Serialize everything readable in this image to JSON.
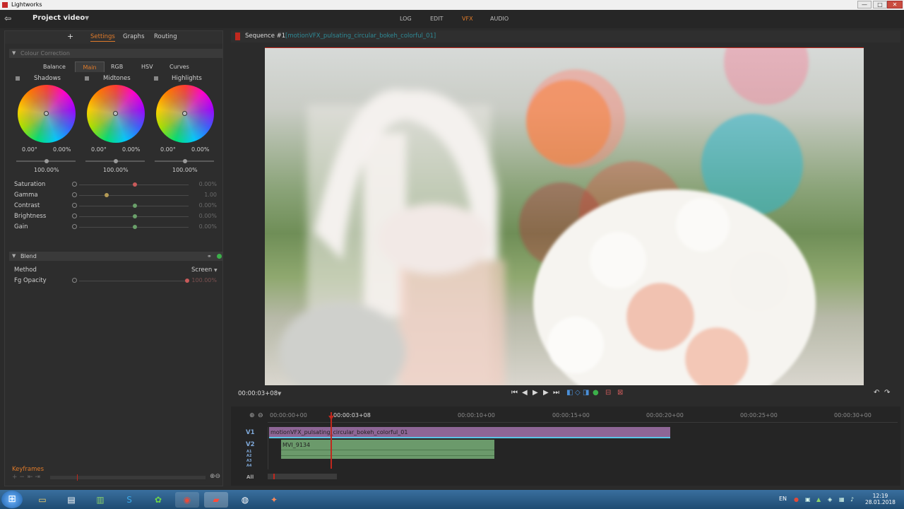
{
  "app": {
    "title": "Lightworks"
  },
  "window_buttons": [
    "—",
    "□",
    "✕"
  ],
  "topbar": {
    "project_name": "Project video",
    "modes": [
      "LOG",
      "EDIT",
      "VFX",
      "AUDIO"
    ]
  },
  "panel": {
    "add": "+",
    "tabs": [
      "Settings",
      "Graphs",
      "Routing"
    ],
    "colour_correction": {
      "title": "Colour Correction",
      "sub_tabs": [
        "Balance",
        "Main",
        "RGB",
        "HSV",
        "Curves"
      ],
      "wheels": [
        {
          "label": "Shadows",
          "val1": "0.00°",
          "val2": "0.00%",
          "level": "100.00%"
        },
        {
          "label": "Midtones",
          "val1": "0.00°",
          "val2": "0.00%",
          "level": "100.00%"
        },
        {
          "label": "Highlights",
          "val1": "0.00°",
          "val2": "0.00%",
          "level": "100.00%"
        }
      ],
      "params": [
        {
          "label": "Saturation",
          "value": "0.00%"
        },
        {
          "label": "Gamma",
          "value": "1.00"
        },
        {
          "label": "Contrast",
          "value": "0.00%"
        },
        {
          "label": "Brightness",
          "value": "0.00%"
        },
        {
          "label": "Gain",
          "value": "0.00%"
        }
      ]
    },
    "blend": {
      "title": "Blend",
      "method_label": "Method",
      "method_value": "Screen",
      "opacity_label": "Fg Opacity",
      "opacity_value": "100.00%"
    },
    "keyframes": "Keyframes"
  },
  "viewer": {
    "sequence": "Sequence #1",
    "clip": "[motionVFX_pulsating_circular_bokeh_colorful_01]",
    "timecode": "00:00:03+08"
  },
  "timeline": {
    "ticks": [
      "00:00:00+00",
      "00:00:10+00",
      "00:00:15+00",
      "00:00:20+00",
      "00:00:25+00",
      "00:00:30+00"
    ],
    "playhead_tc": "00:00:03+08",
    "tracks": [
      "V1",
      "V2",
      "A1",
      "A2",
      "A3",
      "A4",
      "All"
    ],
    "clip_v1": "motionVFX_pulsating_circular_bokeh_colorful_01",
    "clip_v2": "MVI_9134"
  },
  "taskbar": {
    "lang": "EN",
    "time": "12:19",
    "date": "28.01.2018"
  }
}
